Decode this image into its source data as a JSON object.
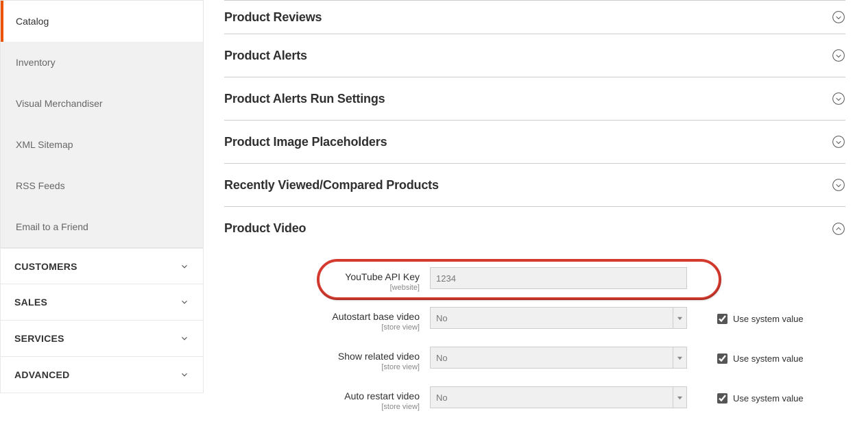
{
  "sidebar": {
    "subnav": [
      {
        "label": "Catalog",
        "active": true
      },
      {
        "label": "Inventory",
        "active": false
      },
      {
        "label": "Visual Merchandiser",
        "active": false
      },
      {
        "label": "XML Sitemap",
        "active": false
      },
      {
        "label": "RSS Feeds",
        "active": false
      },
      {
        "label": "Email to a Friend",
        "active": false
      }
    ],
    "groups": [
      {
        "label": "CUSTOMERS"
      },
      {
        "label": "SALES"
      },
      {
        "label": "SERVICES"
      },
      {
        "label": "ADVANCED"
      }
    ]
  },
  "sections": [
    {
      "label": "Product Reviews",
      "open": false
    },
    {
      "label": "Product Alerts",
      "open": false
    },
    {
      "label": "Product Alerts Run Settings",
      "open": false
    },
    {
      "label": "Product Image Placeholders",
      "open": false
    },
    {
      "label": "Recently Viewed/Compared Products",
      "open": false
    },
    {
      "label": "Product Video",
      "open": true
    }
  ],
  "form": {
    "use_sys_label": "Use system value",
    "youtube": {
      "label": "YouTube API Key",
      "scope": "[website]",
      "value": "1234"
    },
    "autostart": {
      "label": "Autostart base video",
      "scope": "[store view]",
      "value": "No",
      "use_sys": true
    },
    "related": {
      "label": "Show related video",
      "scope": "[store view]",
      "value": "No",
      "use_sys": true
    },
    "restart": {
      "label": "Auto restart video",
      "scope": "[store view]",
      "value": "No",
      "use_sys": true
    }
  }
}
